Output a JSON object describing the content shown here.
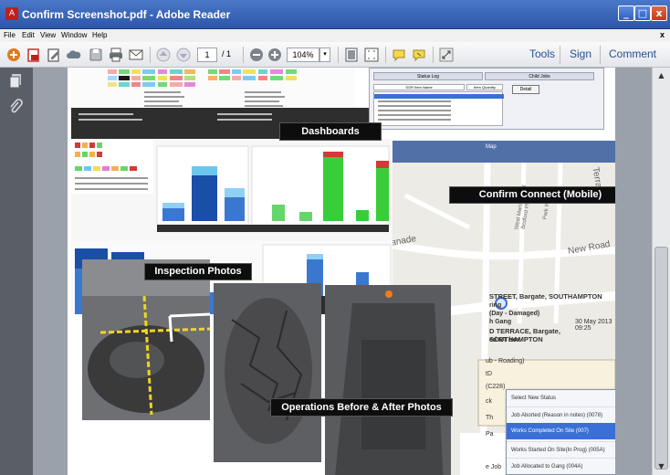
{
  "window": {
    "title": "Confirm Screenshot.pdf - Adobe Reader",
    "min_glyph": "_",
    "max_glyph": "□",
    "close_glyph": "x"
  },
  "menu": {
    "items": [
      "File",
      "Edit",
      "View",
      "Window",
      "Help"
    ],
    "close_glyph": "x"
  },
  "toolbar": {
    "page_current": "1",
    "page_total": "/ 1",
    "zoom": "104%",
    "tools_label": "Tools",
    "sign_label": "Sign",
    "comment_label": "Comment"
  },
  "document": {
    "labels": {
      "dashboards": "Dashboards",
      "mobile": "Confirm Connect (Mobile)",
      "inspection": "Inspection Photos",
      "operations": "Operations Before & After Photos"
    },
    "mobile": {
      "header": "Map",
      "streets": [
        "Esplanade",
        "New Road",
        "Terrace",
        "West Marlands Rd",
        "Park Walk",
        "Bedford Pl"
      ],
      "detail_lines": [
        "STREET, Bargate, SOUTHAMPTON",
        "ring",
        "(Day - Damaged)",
        "h Gang",
        "30 May 2013 09:25",
        "D TERRACE, Bargate, SOUTHAMPTON",
        "ed RT box"
      ],
      "side_lines": [
        "ub - Roading)",
        "tD",
        "(C228)",
        "ck",
        "Th",
        "Pa"
      ],
      "status_options": [
        "Select New Status",
        "Job Aborted (Reason in notes) (0078)",
        "Works Completed On Site (007)",
        "Works Started On Site(In Prog) (005A)",
        "Job Allocated to Gang (004A)"
      ],
      "footer": "e Job"
    },
    "dashboard_table": {
      "status_log": "Status Log",
      "child_jobs": "Child Jobs",
      "col_name": "SOR Item Name",
      "col_qty": "Item Quantity",
      "detail_button": "Detail"
    }
  },
  "colors": {
    "title_bar": "#3a68bc",
    "label_bg": "#0d0d0d",
    "selected_status": "#3a6fd8",
    "link": "#2a4d8f"
  }
}
